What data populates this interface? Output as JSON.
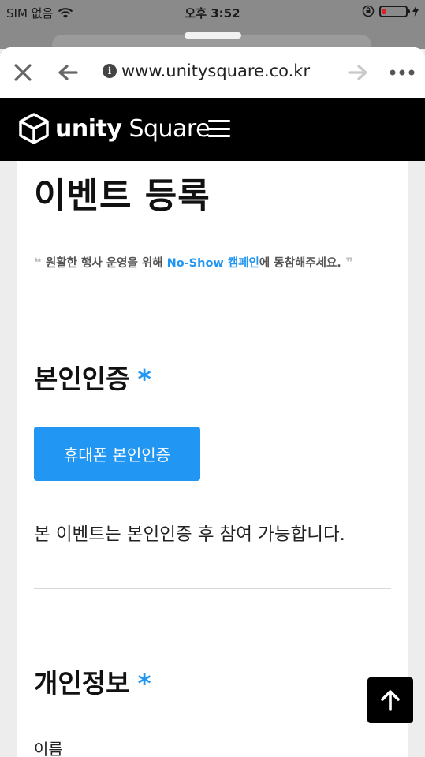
{
  "status_bar": {
    "carrier": "SIM 없음",
    "time": "오후 3:52"
  },
  "browser": {
    "url": "www.unitysquare.co.kr",
    "icons": [
      "close-icon",
      "back-arrow-icon",
      "info-icon",
      "forward-arrow-icon",
      "more-icon"
    ]
  },
  "site": {
    "logo_bold": "unity",
    "logo_light": " Square"
  },
  "page": {
    "title": "이벤트 등록",
    "quote_before": "원활한 행사 운영을 위해 ",
    "quote_link": "No-Show 캠페인",
    "quote_after": "에 동참해주세요.",
    "section_identity": "본인인증",
    "required_mark": "*",
    "verify_button": "휴대폰 본인인증",
    "notice": "본 이벤트는 본인인증 후 참여 가능합니다.",
    "section_personal": "개인정보",
    "name_label": "이름"
  },
  "colors": {
    "accent": "#2196f3",
    "header_bg": "#000000",
    "battery_low": "#e02020"
  }
}
